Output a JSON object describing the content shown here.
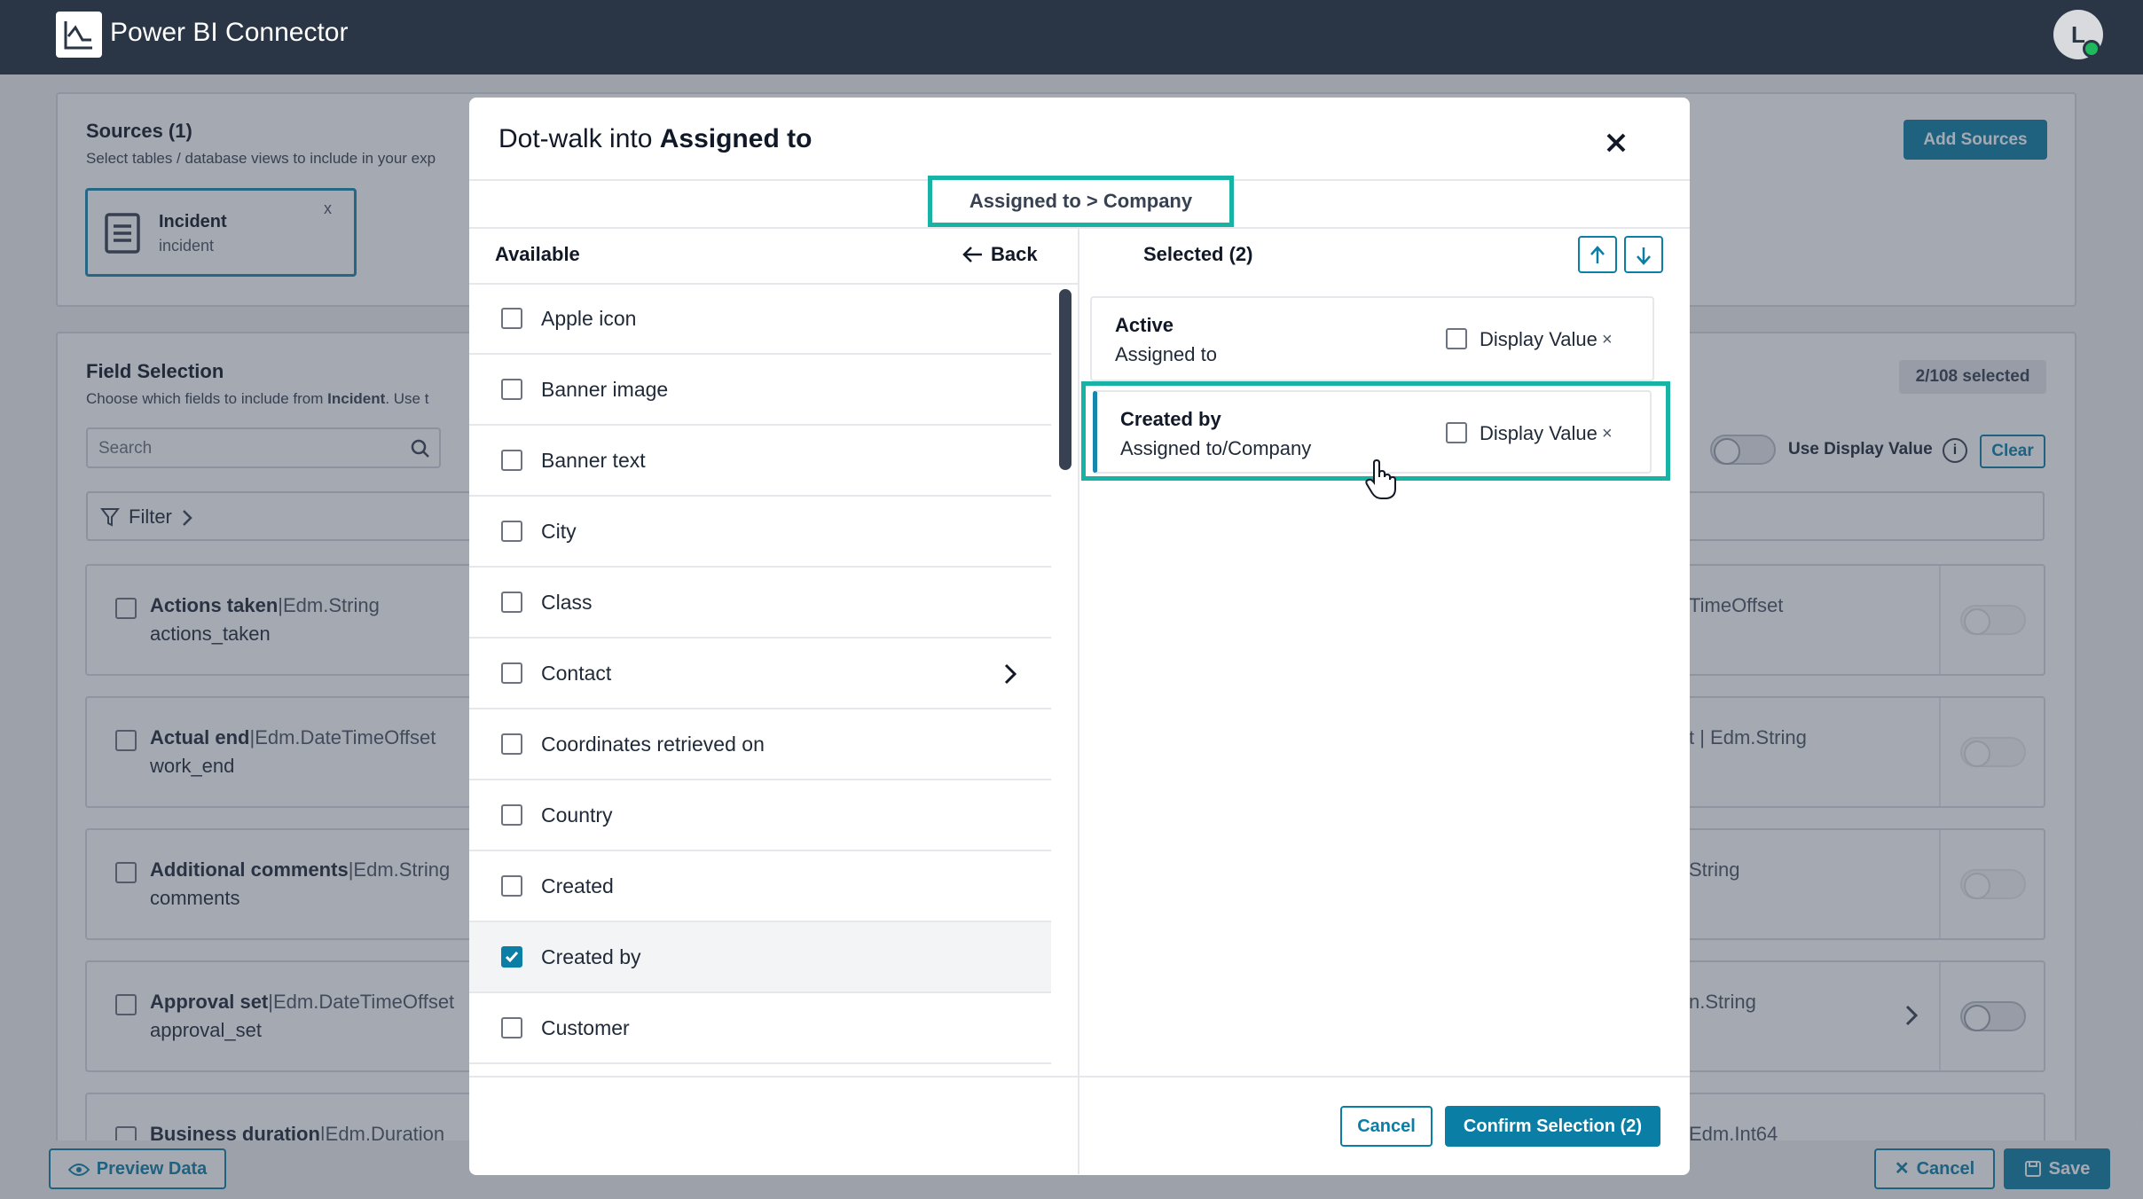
{
  "app": {
    "title": "Power BI Connector",
    "avatar_initial": "L"
  },
  "sources": {
    "title": "Sources (1)",
    "subtitle": "Select tables / database views to include in your exp",
    "add_button": "Add Sources",
    "chip": {
      "name": "Incident",
      "table": "incident",
      "remove": "x"
    }
  },
  "fields": {
    "title": "Field Selection",
    "subtitle_prefix": "Choose which fields to include from ",
    "subtitle_bold": "Incident",
    "subtitle_suffix": ". Use t",
    "search_placeholder": "Search",
    "filter_label": "Filter",
    "selected_badge": "2/108 selected",
    "use_display_value": "Use Display Value",
    "clear": "Clear",
    "rows": [
      {
        "name": "Actions taken",
        "type": "Edm.String",
        "key": "actions_taken",
        "right": "TimeOffset"
      },
      {
        "name": "Actual end",
        "type": "Edm.DateTimeOffset",
        "key": "work_end",
        "right": "t | Edm.String"
      },
      {
        "name": "Additional comments",
        "type": "Edm.String",
        "key": "comments",
        "right": "String"
      },
      {
        "name": "Approval set",
        "type": "Edm.DateTimeOffset",
        "key": "approval_set",
        "right": "n.String"
      },
      {
        "name": "Business duration",
        "type": "Edm.Duration",
        "key": "duration",
        "right": "Edm.Int64"
      }
    ],
    "separator": "|"
  },
  "footer": {
    "preview": "Preview Data",
    "cancel": "Cancel",
    "save": "Save"
  },
  "modal": {
    "title_prefix": "Dot-walk into ",
    "title_bold": "Assigned to",
    "breadcrumb": "Assigned to > Company",
    "available_label": "Available",
    "back_label": "Back",
    "selected_label": "Selected (2)",
    "available": [
      {
        "label": "Apple icon",
        "checked": false
      },
      {
        "label": "Banner image",
        "checked": false
      },
      {
        "label": "Banner text",
        "checked": false
      },
      {
        "label": "City",
        "checked": false
      },
      {
        "label": "Class",
        "checked": false
      },
      {
        "label": "Contact",
        "checked": false
      },
      {
        "label": "Coordinates retrieved on",
        "checked": false
      },
      {
        "label": "Country",
        "checked": false
      },
      {
        "label": "Created",
        "checked": false
      },
      {
        "label": "Created by",
        "checked": true
      },
      {
        "label": "Customer",
        "checked": false
      }
    ],
    "selected": [
      {
        "title": "Active",
        "path": "Assigned to",
        "display_value": "Display Value",
        "remove": "×"
      },
      {
        "title": "Created by",
        "path": "Assigned to/Company",
        "display_value": "Display Value",
        "remove": "×"
      }
    ],
    "cancel_label": "Cancel",
    "confirm_label": "Confirm Selection (2)"
  },
  "colors": {
    "accent": "#0b7ea6",
    "highlight": "#18b3a4",
    "topbar": "#2a3545"
  }
}
